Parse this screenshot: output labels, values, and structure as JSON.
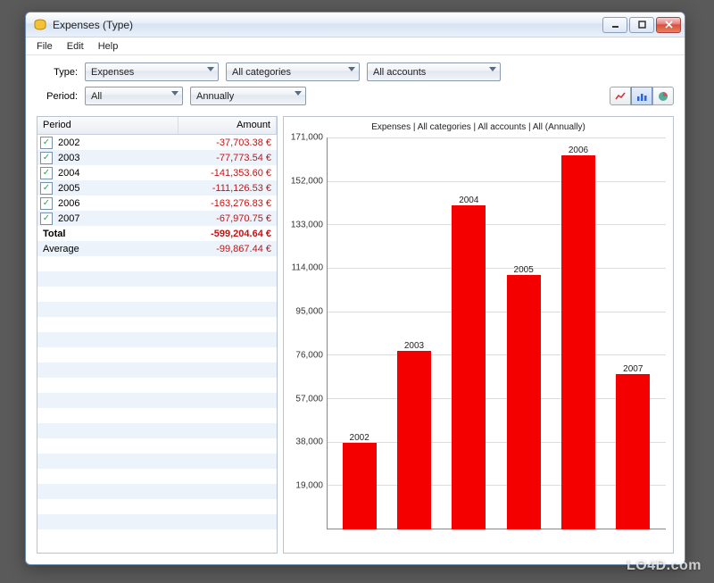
{
  "window": {
    "title": "Expenses (Type)"
  },
  "menubar": {
    "items": [
      "File",
      "Edit",
      "Help"
    ]
  },
  "filters": {
    "type_label": "Type:",
    "period_label": "Period:",
    "type_value": "Expenses",
    "category_value": "All categories",
    "account_value": "All accounts",
    "period_value": "All",
    "interval_value": "Annually"
  },
  "view_buttons": {
    "line": "line",
    "bar": "bar",
    "pie": "pie"
  },
  "table": {
    "headers": {
      "period": "Period",
      "amount": "Amount"
    },
    "rows": [
      {
        "period": "2002",
        "amount": "-37,703.38 €",
        "checked": true
      },
      {
        "period": "2003",
        "amount": "-77,773.54 €",
        "checked": true
      },
      {
        "period": "2004",
        "amount": "-141,353.60 €",
        "checked": true
      },
      {
        "period": "2005",
        "amount": "-111,126.53 €",
        "checked": true
      },
      {
        "period": "2006",
        "amount": "-163,276.83 €",
        "checked": true
      },
      {
        "period": "2007",
        "amount": "-67,970.75 €",
        "checked": true
      }
    ],
    "total_label": "Total",
    "total_value": "-599,204.64 €",
    "average_label": "Average",
    "average_value": "-99,867.44 €"
  },
  "chart_data": {
    "type": "bar",
    "title": "Expenses | All categories | All accounts | All (Annually)",
    "categories": [
      "2002",
      "2003",
      "2004",
      "2005",
      "2006",
      "2007"
    ],
    "values": [
      37703,
      77774,
      141354,
      111127,
      163277,
      67971
    ],
    "ylabel": "",
    "xlabel": "",
    "ylim": [
      0,
      171000
    ],
    "yticks": [
      19000,
      38000,
      57000,
      76000,
      95000,
      114000,
      133000,
      152000,
      171000
    ],
    "ytick_labels": [
      "19,000",
      "38,000",
      "57,000",
      "76,000",
      "95,000",
      "114,000",
      "133,000",
      "152,000",
      "171,000"
    ],
    "bar_color": "#f50000"
  },
  "watermark": "LO4D.com"
}
